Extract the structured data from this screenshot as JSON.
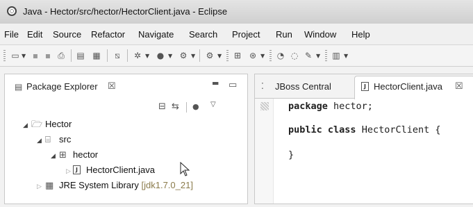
{
  "window": {
    "title": "Java - Hector/src/hector/HectorClient.java - Eclipse"
  },
  "menu": [
    "File",
    "Edit",
    "Source",
    "Refactor",
    "Navigate",
    "Search",
    "Project",
    "Run",
    "Window",
    "Help"
  ],
  "package_explorer": {
    "tab_label": "Package Explorer",
    "close_glyph": "☒",
    "tree": {
      "project": "Hector",
      "src": "src",
      "package": "hector",
      "file": "HectorClient.java",
      "jre_label": "JRE System Library",
      "jre_version": "[jdk1.7.0_21]"
    }
  },
  "editor": {
    "tabs": [
      {
        "label": "JBoss Central"
      },
      {
        "label": "HectorClient.java",
        "close_glyph": "☒"
      }
    ],
    "code": {
      "line1_kw": "package",
      "line1_rest": " hector;",
      "line2_kw1": "public",
      "line2_kw2": "class",
      "line2_rest": " HectorClient {",
      "line3": "}"
    }
  },
  "icons": {
    "title": "eclipse-icon",
    "file_glyph": "J"
  }
}
